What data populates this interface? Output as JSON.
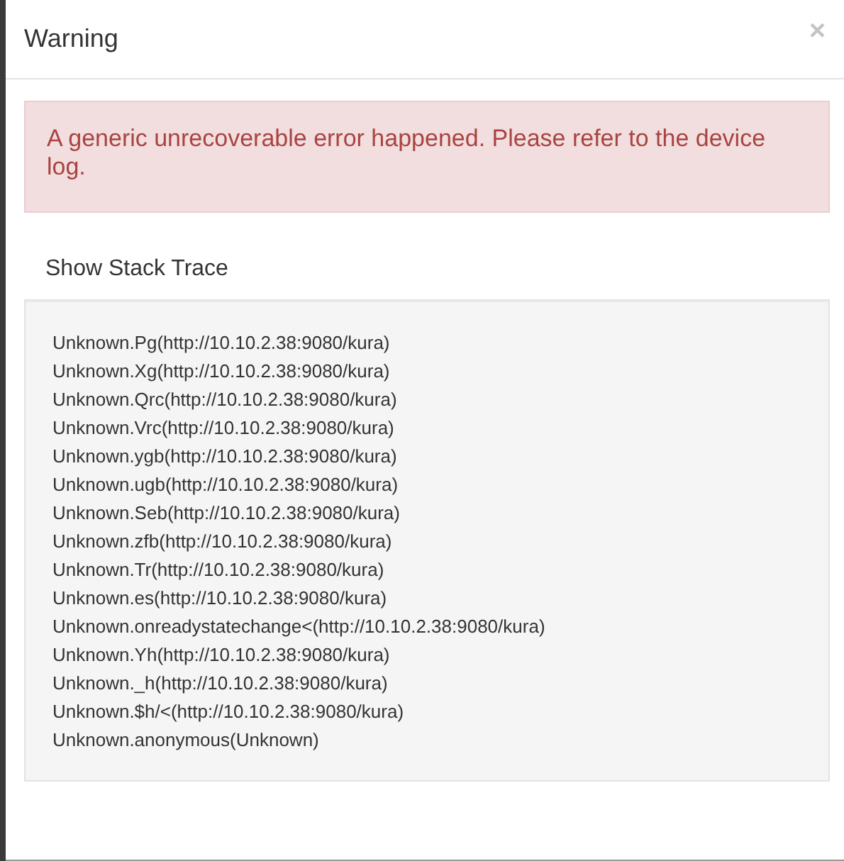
{
  "dialog": {
    "title": "Warning",
    "close": "×"
  },
  "alert": {
    "message": "A generic unrecoverable error happened. Please refer to the device log."
  },
  "stack_trace": {
    "toggle": "Show Stack Trace",
    "lines": [
      "Unknown.Pg(http://10.10.2.38:9080/kura)",
      "Unknown.Xg(http://10.10.2.38:9080/kura)",
      "Unknown.Qrc(http://10.10.2.38:9080/kura)",
      "Unknown.Vrc(http://10.10.2.38:9080/kura)",
      "Unknown.ygb(http://10.10.2.38:9080/kura)",
      "Unknown.ugb(http://10.10.2.38:9080/kura)",
      "Unknown.Seb(http://10.10.2.38:9080/kura)",
      "Unknown.zfb(http://10.10.2.38:9080/kura)",
      "Unknown.Tr(http://10.10.2.38:9080/kura)",
      "Unknown.es(http://10.10.2.38:9080/kura)",
      "Unknown.onreadystatechange<(http://10.10.2.38:9080/kura)",
      "Unknown.Yh(http://10.10.2.38:9080/kura)",
      "Unknown._h(http://10.10.2.38:9080/kura)",
      "Unknown.$h/<(http://10.10.2.38:9080/kura)",
      "Unknown.anonymous(Unknown)"
    ]
  }
}
